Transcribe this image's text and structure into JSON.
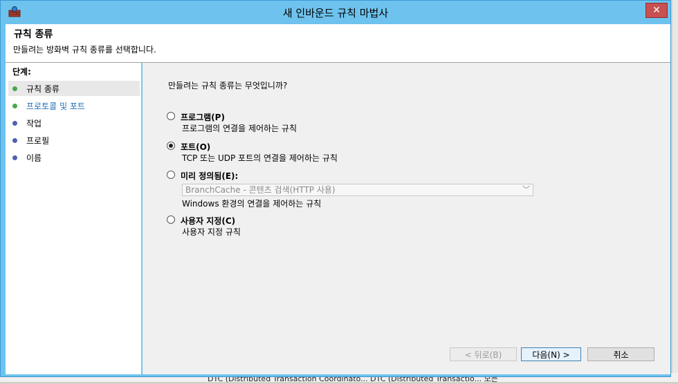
{
  "window": {
    "title": "새 인바운드 규칙 마법사",
    "close_glyph": "✕"
  },
  "header": {
    "title": "규칙 종류",
    "subtitle": "만들려는 방화벽 규칙 종류를 선택합니다."
  },
  "steps": {
    "title": "단계:",
    "items": [
      {
        "label": "규칙 종류",
        "status": "done"
      },
      {
        "label": "프로토콜 및 포트",
        "status": "done"
      },
      {
        "label": "작업",
        "status": "pending"
      },
      {
        "label": "프로필",
        "status": "pending"
      },
      {
        "label": "이름",
        "status": "pending"
      }
    ]
  },
  "main": {
    "question": "만들려는 규칙 종류는 무엇입니까?",
    "options": [
      {
        "label": "프로그램(P)",
        "desc": "프로그램의 연결을 제어하는 규칙",
        "selected": false
      },
      {
        "label": "포트(O)",
        "desc": "TCP 또는 UDP 포트의 연결을 제어하는 규칙",
        "selected": true
      },
      {
        "label": "미리 정의됨(E):",
        "desc": "Windows 환경의 연결을 제어하는 규칙",
        "selected": false
      },
      {
        "label": "사용자 지정(C)",
        "desc": "사용자 지정 규칙",
        "selected": false
      }
    ],
    "predefined_select": {
      "value": "BranchCache - 콘텐츠 검색(HTTP 사용)",
      "disabled": true
    }
  },
  "buttons": {
    "back": "< 뒤로(B)",
    "next": "다음(N) >",
    "cancel": "취소"
  },
  "background": {
    "strip_text": "DTC (Distributed Transaction Coordinato... DTC (Distributed Transactio... 모든"
  },
  "colors": {
    "title_bar": "#6ec3ee",
    "done_dot": "#4aa84a",
    "pending_dot": "#5060b0",
    "link": "#1f6db5"
  }
}
